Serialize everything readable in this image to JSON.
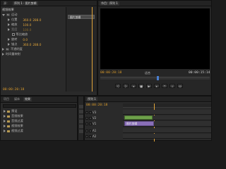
{
  "effect_controls": {
    "tab_main": "源：",
    "tab_sequence": "序列 1 · 图片剪辑",
    "clip_label": "图片剪辑",
    "section_video": "视频效果",
    "motion": "运动",
    "position_label": "位置",
    "position_x": "360.0",
    "position_y": "288.0",
    "scale_label": "缩放",
    "scale_value": "100.0",
    "scale_width_label": "宽度",
    "uniform_scale": "等比缩放",
    "rotation_label": "旋转",
    "rotation_value": "0.0",
    "anchor_label": "锚点",
    "anchor_x": "360.0",
    "anchor_y": "288.0",
    "opacity": "不透明度",
    "time_remap": "时间重映射",
    "timecode": "00:00:20:18"
  },
  "program_monitor": {
    "tab": "节目：序列 1",
    "timecode_left": "00:00:20:18",
    "fit_label": "适合",
    "timecode_right": "00:00:15:14"
  },
  "project_panel": {
    "tabs": [
      "项目",
      "媒体",
      "效果"
    ],
    "items": [
      {
        "label": "预设"
      },
      {
        "label": "音频效果"
      },
      {
        "label": "音频过渡"
      },
      {
        "label": "视频效果"
      },
      {
        "label": "视频过渡"
      }
    ]
  },
  "timeline": {
    "tab": "序列 1",
    "timecode": "00:00:20:18",
    "clip_name": "图片剪辑",
    "tracks": [
      "V3",
      "V2",
      "V1",
      "A1",
      "A2"
    ]
  },
  "colors": {
    "accent_orange": "#e0a43a",
    "clip_purple": "#8a6fb8",
    "clip_green": "#6ea04a"
  }
}
